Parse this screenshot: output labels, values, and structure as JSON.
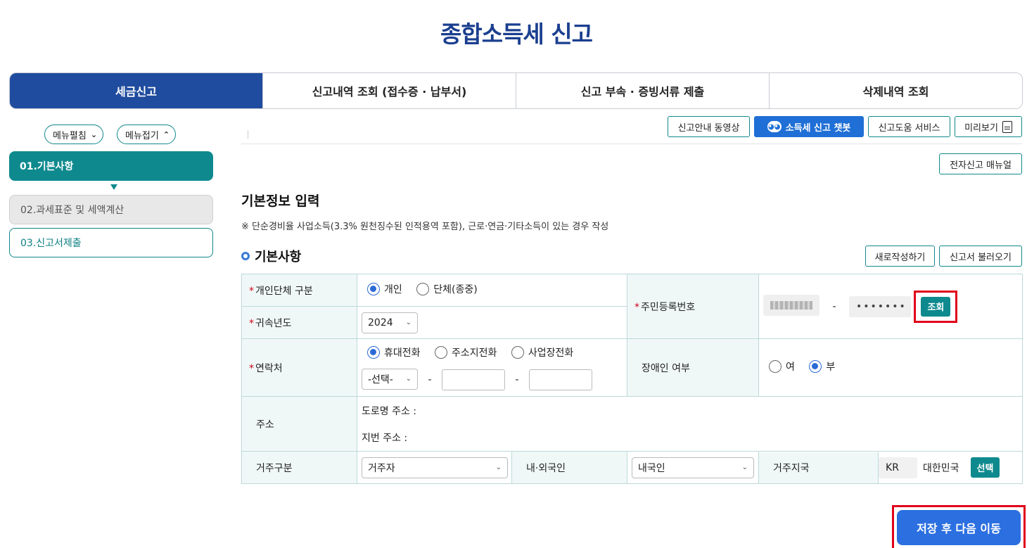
{
  "page_title": "종합소득세 신고",
  "tabs": [
    {
      "label": "세금신고",
      "active": true
    },
    {
      "label": "신고내역 조회 (접수증 · 납부서)",
      "active": false
    },
    {
      "label": "신고 부속 · 증빙서류 제출",
      "active": false
    },
    {
      "label": "삭제내역 조회",
      "active": false
    }
  ],
  "sidebar": {
    "expand_label": "메뉴펼침",
    "collapse_label": "메뉴접기",
    "steps": [
      {
        "label": "01.기본사항",
        "state": "active"
      },
      {
        "label": "02.과세표준 및 세액계산",
        "state": "disabled"
      },
      {
        "label": "03.신고서제출",
        "state": "pending"
      }
    ]
  },
  "toolbar": {
    "video_guide": "신고안내 동영상",
    "chatbot": "소득세 신고 챗봇",
    "help_service": "신고도움 서비스",
    "preview": "미리보기",
    "manual": "전자신고 매뉴얼"
  },
  "section": {
    "title": "기본정보 입력",
    "note": "※ 단순경비율 사업소득(3.3% 원천징수된 인적용역 포함), 근로·연금·기타소득이 있는 경우 작성"
  },
  "basic": {
    "title": "기본사항",
    "new_label": "새로작성하기",
    "load_label": "신고서 불러오기"
  },
  "form": {
    "type_label": "개인단체 구분",
    "type_options": [
      "개인",
      "단체(종중)"
    ],
    "type_selected": "개인",
    "year_label": "귀속년도",
    "year_value": "2024",
    "rrn_label": "주민등록번호",
    "rrn_second": "•••••••",
    "lookup_label": "조회",
    "contact_label": "연락처",
    "contact_options": [
      "휴대전화",
      "주소지전화",
      "사업장전화"
    ],
    "contact_selected": "휴대전화",
    "phone_prefix": "-선택-",
    "disability_label": "장애인 여부",
    "disability_options": [
      "여",
      "부"
    ],
    "disability_selected": "부",
    "address_label": "주소",
    "road_address_label": "도로명 주소 :",
    "lot_address_label": "지번 주소 :",
    "residence_label": "거주구분",
    "residence_value": "거주자",
    "nationality_label": "내·외국인",
    "nationality_value": "내국인",
    "country_label": "거주지국",
    "country_code": "KR",
    "country_name": "대한민국",
    "country_select_label": "선택"
  },
  "next_button": "저장 후 다음 이동",
  "colors": {
    "primary_blue": "#1f4c9e",
    "teal": "#0e8a8e",
    "highlight_red": "#e0001b",
    "button_blue": "#2b6fe0"
  }
}
